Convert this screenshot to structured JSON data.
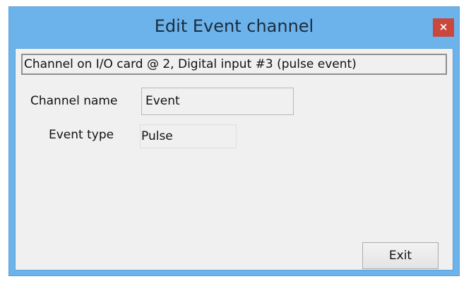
{
  "window": {
    "title": "Edit Event channel",
    "close_label": "×",
    "accent": "#6cb3ec",
    "close_color": "#c9473c"
  },
  "dialog": {
    "description": "Channel on I/O card @ 2, Digital input #3 (pulse event)",
    "channel_name_label": "Channel name",
    "channel_name_value": "Event",
    "event_type_label": "Event type",
    "event_type_value": "Pulse",
    "exit_label": "Exit"
  }
}
